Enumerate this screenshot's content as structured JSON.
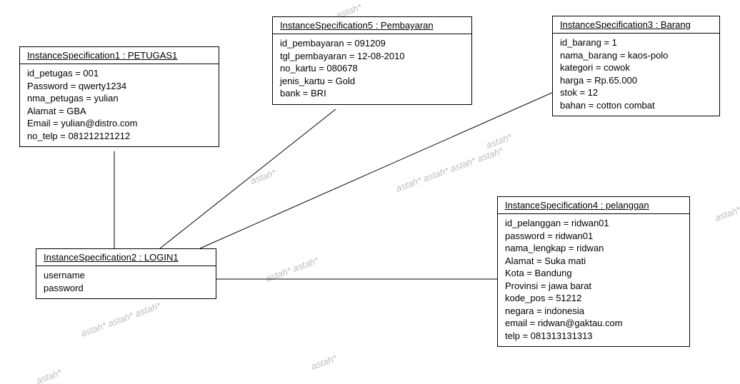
{
  "watermark": "astah*",
  "boxes": {
    "petugas": {
      "title": "InstanceSpecification1 : PETUGAS1",
      "attrs": [
        "id_petugas = 001",
        "Password = qwerty1234",
        "nma_petugas = yulian",
        "Alamat = GBA",
        "Email = yulian@distro.com",
        "no_telp = 081212121212"
      ]
    },
    "pembayaran": {
      "title": "InstanceSpecification5 : Pembayaran",
      "attrs": [
        "id_pembayaran = 091209",
        "tgl_pembayaran = 12-08-2010",
        "no_kartu = 080678",
        "jenis_kartu = Gold",
        "bank = BRI"
      ]
    },
    "barang": {
      "title": "InstanceSpecification3 : Barang",
      "attrs": [
        "id_barang = 1",
        "nama_barang = kaos-polo",
        "kategori = cowok",
        "harga = Rp.65.000",
        "stok = 12",
        "bahan = cotton combat"
      ]
    },
    "login": {
      "title": "InstanceSpecification2 : LOGIN1",
      "attrs": [
        "username",
        "password"
      ]
    },
    "pelanggan": {
      "title": "InstanceSpecification4 : pelanggan",
      "attrs": [
        "id_pelanggan = ridwan01",
        "password = ridwan01",
        "nama_lengkap = ridwan",
        "Alamat = Suka mati",
        "Kota = Bandung",
        "Provinsi = jawa barat",
        "kode_pos = 51212",
        "negara = indonesia",
        "email = ridwan@gaktau.com",
        "telp = 081313131313"
      ]
    }
  },
  "chart_data": {
    "type": "uml-object-diagram",
    "title": "",
    "objects": [
      {
        "name": "InstanceSpecification1",
        "classifier": "PETUGAS1",
        "slots": {
          "id_petugas": "001",
          "Password": "qwerty1234",
          "nma_petugas": "yulian",
          "Alamat": "GBA",
          "Email": "yulian@distro.com",
          "no_telp": "081212121212"
        }
      },
      {
        "name": "InstanceSpecification2",
        "classifier": "LOGIN1",
        "slots": {
          "username": "",
          "password": ""
        }
      },
      {
        "name": "InstanceSpecification3",
        "classifier": "Barang",
        "slots": {
          "id_barang": "1",
          "nama_barang": "kaos-polo",
          "kategori": "cowok",
          "harga": "Rp.65.000",
          "stok": "12",
          "bahan": "cotton combat"
        }
      },
      {
        "name": "InstanceSpecification4",
        "classifier": "pelanggan",
        "slots": {
          "id_pelanggan": "ridwan01",
          "password": "ridwan01",
          "nama_lengkap": "ridwan",
          "Alamat": "Suka mati",
          "Kota": "Bandung",
          "Provinsi": "jawa barat",
          "kode_pos": "51212",
          "negara": "indonesia",
          "email": "ridwan@gaktau.com",
          "telp": "081313131313"
        }
      },
      {
        "name": "InstanceSpecification5",
        "classifier": "Pembayaran",
        "slots": {
          "id_pembayaran": "091209",
          "tgl_pembayaran": "12-08-2010",
          "no_kartu": "080678",
          "jenis_kartu": "Gold",
          "bank": "BRI"
        }
      }
    ],
    "links": [
      {
        "from": "InstanceSpecification1",
        "to": "InstanceSpecification2"
      },
      {
        "from": "InstanceSpecification5",
        "to": "InstanceSpecification2"
      },
      {
        "from": "InstanceSpecification3",
        "to": "InstanceSpecification2"
      },
      {
        "from": "InstanceSpecification4",
        "to": "InstanceSpecification2"
      }
    ]
  }
}
